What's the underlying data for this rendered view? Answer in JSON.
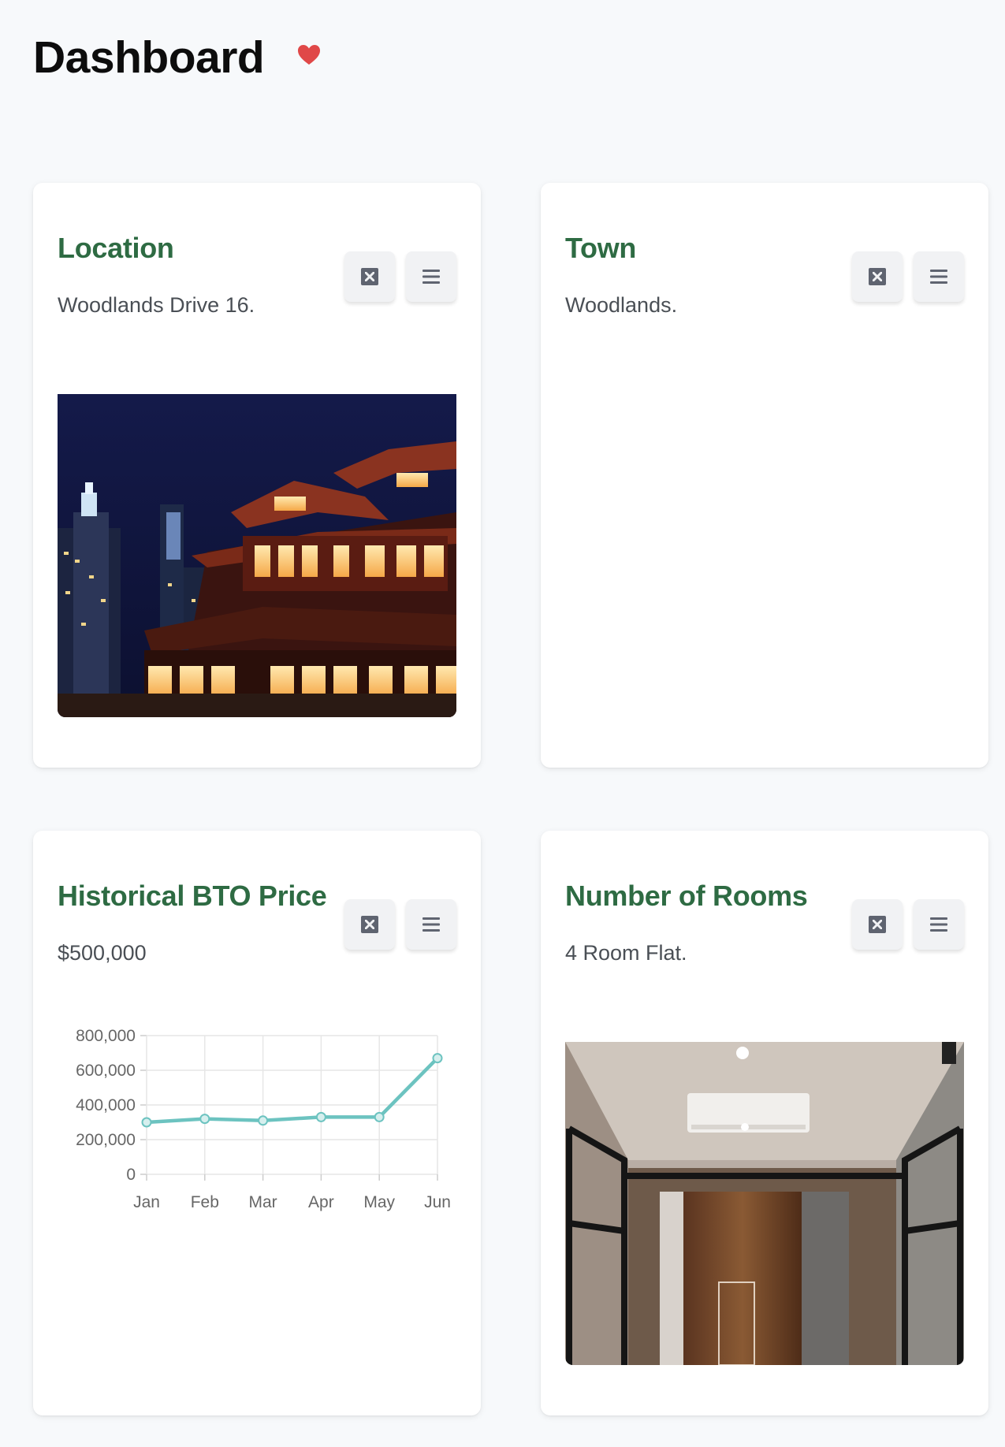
{
  "page": {
    "title": "Dashboard"
  },
  "cards": {
    "location": {
      "title": "Location",
      "value": "Woodlands Drive 16."
    },
    "town": {
      "title": "Town",
      "value": "Woodlands."
    },
    "price": {
      "title": "Historical BTO Price",
      "value": "$500,000"
    },
    "rooms": {
      "title": "Number of Rooms",
      "value": "4 Room Flat."
    }
  },
  "icons": {
    "expand": "expand-icon",
    "menu": "hamburger-menu-icon",
    "heart": "heart-icon"
  },
  "colors": {
    "title_green": "#2e6b43",
    "heart_red": "#e04848",
    "line_teal": "#6cc3c0"
  },
  "chart_data": {
    "type": "line",
    "categories": [
      "Jan",
      "Feb",
      "Mar",
      "Apr",
      "May",
      "Jun"
    ],
    "series": [
      {
        "values": [
          300000,
          320000,
          310000,
          330000,
          330000,
          670000
        ]
      }
    ],
    "yticks": [
      "0",
      "200,000",
      "400,000",
      "600,000",
      "800,000"
    ],
    "ylim": [
      0,
      800000
    ],
    "grid": true,
    "legend": "none",
    "xlabel": "",
    "ylabel": ""
  }
}
